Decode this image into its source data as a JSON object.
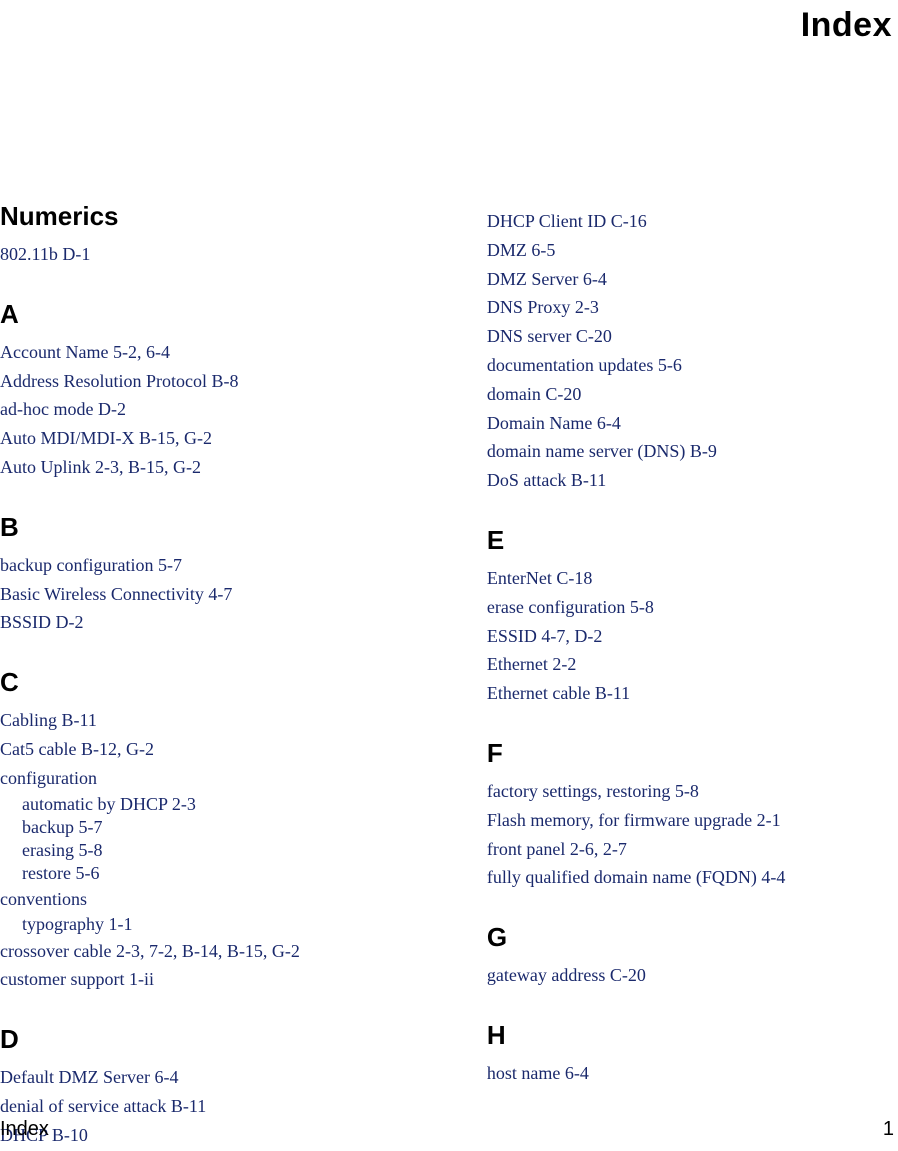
{
  "title": "Index",
  "footer": {
    "label": "Index",
    "page": "1"
  },
  "left": {
    "numerics": {
      "head": "Numerics",
      "items": [
        "802.11b  D-1"
      ]
    },
    "A": {
      "head": "A",
      "items": [
        "Account Name  5-2, 6-4",
        "Address Resolution Protocol  B-8",
        "ad-hoc mode  D-2",
        "Auto MDI/MDI-X  B-15, G-2",
        "Auto Uplink  2-3, B-15, G-2"
      ]
    },
    "B": {
      "head": "B",
      "items": [
        "backup configuration  5-7",
        "Basic Wireless Connectivity  4-7",
        "BSSID  D-2"
      ]
    },
    "C": {
      "head": "C",
      "items": [
        "Cabling  B-11",
        "Cat5 cable  B-12, G-2"
      ],
      "configuration": {
        "label": "configuration",
        "subs": [
          "automatic by DHCP  2-3",
          "backup  5-7",
          "erasing  5-8",
          "restore  5-6"
        ]
      },
      "conventions": {
        "label": "conventions",
        "subs": [
          "typography  1-1"
        ]
      },
      "tail": [
        "crossover cable  2-3, 7-2, B-14, B-15, G-2",
        "customer support  1-ii"
      ]
    },
    "D": {
      "head": "D",
      "items": [
        "Default DMZ Server  6-4",
        "denial of service attack  B-11",
        "DHCP  B-10"
      ]
    }
  },
  "right": {
    "Dcont": {
      "items": [
        "DHCP Client ID  C-16",
        "DMZ  6-5",
        "DMZ Server  6-4",
        "DNS Proxy  2-3",
        "DNS server  C-20",
        "documentation updates  5-6",
        "domain  C-20",
        "Domain Name  6-4",
        "domain name server (DNS)  B-9",
        "DoS attack  B-11"
      ]
    },
    "E": {
      "head": "E",
      "items": [
        "EnterNet  C-18",
        "erase configuration  5-8",
        "ESSID  4-7, D-2",
        "Ethernet  2-2",
        "Ethernet cable  B-11"
      ]
    },
    "F": {
      "head": "F",
      "items": [
        "factory settings, restoring  5-8",
        "Flash memory, for firmware upgrade  2-1",
        "front panel  2-6, 2-7",
        "fully qualified domain name (FQDN)  4-4"
      ]
    },
    "G": {
      "head": "G",
      "items": [
        "gateway address  C-20"
      ]
    },
    "H": {
      "head": "H",
      "items": [
        "host name  6-4"
      ]
    }
  }
}
